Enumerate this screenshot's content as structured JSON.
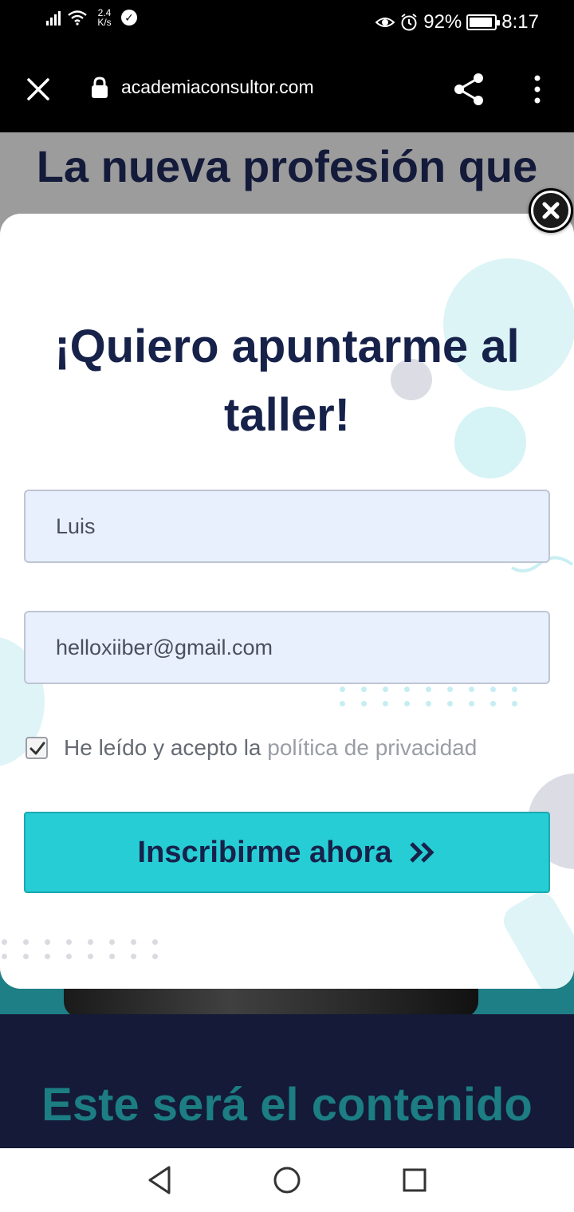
{
  "status_bar": {
    "net_speed_value": "2.4",
    "net_speed_unit": "K/s",
    "battery": "92%",
    "battery_level": 0.92,
    "time": "8:17"
  },
  "browser": {
    "url": "academiaconsultor.com"
  },
  "page": {
    "hero_title_top": "La nueva profesión que",
    "section_title": "Este será el contenido"
  },
  "modal": {
    "title": "¡Quiero apuntarme al taller!",
    "name_value": "Luis",
    "email_value": "helloxiiber@gmail.com",
    "consent_text": "He leído y acepto la",
    "consent_link": "política de privacidad",
    "consent_checked": true,
    "submit_label": "Inscribirme ahora"
  },
  "colors": {
    "accent": "#26cdd4",
    "title_navy": "#17224a",
    "field_bg": "#e8f0fe",
    "section_teal": "#1c7d83"
  },
  "icons": [
    "signal-icon",
    "wifi-icon",
    "check-circle-icon",
    "eye-icon",
    "alarm-icon",
    "battery-icon",
    "close-icon",
    "lock-icon",
    "share-icon",
    "more-vert-icon",
    "checkmark-icon",
    "double-chevron-right-icon",
    "back-icon",
    "home-icon",
    "recent-apps-icon"
  ]
}
